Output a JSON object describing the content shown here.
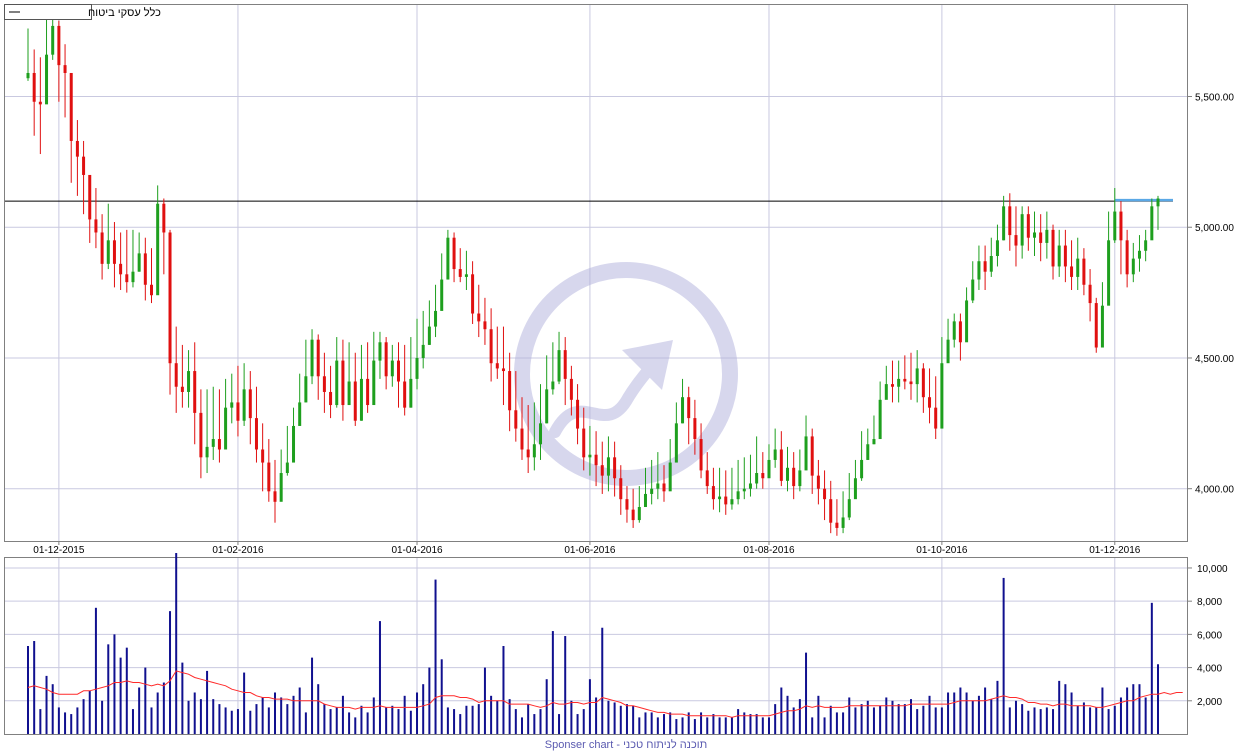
{
  "legend": {
    "instrument": "כלל עסקי ביטוח"
  },
  "footer": {
    "text": "Sponser chart - תוכנה לניתוח טכני"
  },
  "colors": {
    "up": "#1e9f1e",
    "down": "#e01010",
    "volume": "#10108f",
    "volume_ma": "#ff2a2a",
    "grid": "#c9c9e0",
    "resistance": "#000000",
    "trendline": "#5aa8e6",
    "watermark": "#b0b0dc"
  },
  "chart_data": [
    {
      "type": "candlestick",
      "title": "",
      "x_tick_labels": [
        "01-12-2015",
        "01-02-2016",
        "01-04-2016",
        "01-06-2016",
        "01-08-2016",
        "01-10-2016",
        "01-12-2016"
      ],
      "y_tick_labels": [
        "4,000.00",
        "4,500.00",
        "5,000.00",
        "5,500.00"
      ],
      "y_ticks": [
        4000,
        4500,
        5000,
        5500
      ],
      "ylim": [
        3800,
        5850
      ],
      "grid": true,
      "horizontal_line": {
        "value": 5100
      },
      "trendline": {
        "from": "01-12-2016",
        "to": "last",
        "value": 5100
      },
      "series": [
        {
          "name": "",
          "close": [
            5590,
            5480,
            5470,
            5660,
            5770,
            5620,
            5590,
            5330,
            5270,
            5200,
            5030,
            4980,
            4860,
            4950,
            4860,
            4820,
            4790,
            4830,
            4900,
            4780,
            4740,
            5090,
            4980,
            4480,
            4390,
            4370,
            4450,
            4290,
            4120,
            4160,
            4190,
            4150,
            4310,
            4330,
            4260,
            4380,
            4270,
            4150,
            4100,
            3990,
            3950,
            4060,
            4100,
            4240,
            4330,
            4430,
            4570,
            4430,
            4370,
            4320,
            4490,
            4320,
            4410,
            4260,
            4420,
            4320,
            4490,
            4560,
            4430,
            4490,
            4410,
            4310,
            4420,
            4500,
            4550,
            4620,
            4680,
            4800,
            4960,
            4840,
            4810,
            4820,
            4670,
            4640,
            4610,
            4480,
            4460,
            4450,
            4300,
            4230,
            4150,
            4120,
            4170,
            4250,
            4380,
            4410,
            4530,
            4420,
            4340,
            4230,
            4120,
            4130,
            4090,
            4050,
            4120,
            4040,
            3960,
            3920,
            3880,
            3930,
            3980,
            4000,
            4020,
            3990,
            4100,
            4250,
            4350,
            4270,
            4190,
            4070,
            4010,
            3960,
            3970,
            3940,
            3960,
            3990,
            4000,
            4020,
            4060,
            4040,
            4110,
            4150,
            4030,
            4080,
            4010,
            4070,
            4200,
            4050,
            4000,
            3960,
            3870,
            3850,
            3890,
            3960,
            4040,
            4110,
            4170,
            4190,
            4340,
            4400,
            4390,
            4420,
            4410,
            4400,
            4460,
            4350,
            4310,
            4230,
            4480,
            4570,
            4640,
            4560,
            4720,
            4800,
            4870,
            4830,
            4890,
            4950,
            5080,
            4970,
            4930,
            5050,
            4960,
            4980,
            4940,
            4990,
            4850,
            4930,
            4850,
            4810,
            4880,
            4780,
            4710,
            4540,
            4700,
            4950,
            5060,
            4950,
            4820,
            4880,
            4910,
            4950,
            5080,
            5110
          ],
          "high": [
            5760,
            5680,
            5650,
            5800,
            5830,
            5790,
            5700,
            5540,
            5410,
            5330,
            5190,
            5150,
            5050,
            5090,
            5020,
            4980,
            4990,
            4990,
            4980,
            4960,
            4920,
            5160,
            5110,
            4990,
            4620,
            4550,
            4530,
            4560,
            4380,
            4380,
            4390,
            4380,
            4420,
            4440,
            4470,
            4480,
            4450,
            4390,
            4250,
            4190,
            4110,
            4150,
            4240,
            4310,
            4440,
            4570,
            4610,
            4590,
            4520,
            4470,
            4580,
            4570,
            4560,
            4520,
            4550,
            4560,
            4600,
            4600,
            4580,
            4550,
            4560,
            4550,
            4580,
            4650,
            4680,
            4720,
            4780,
            4900,
            4990,
            4980,
            4920,
            4910,
            4870,
            4780,
            4730,
            4690,
            4620,
            4620,
            4520,
            4450,
            4350,
            4320,
            4330,
            4400,
            4510,
            4560,
            4600,
            4580,
            4470,
            4400,
            4310,
            4240,
            4220,
            4180,
            4200,
            4180,
            4090,
            4010,
            4000,
            4010,
            4080,
            4110,
            4140,
            4090,
            4190,
            4330,
            4420,
            4390,
            4340,
            4250,
            4140,
            4080,
            4080,
            4070,
            4080,
            4110,
            4120,
            4130,
            4200,
            4140,
            4170,
            4230,
            4220,
            4160,
            4140,
            4150,
            4280,
            4230,
            4110,
            4070,
            4030,
            3960,
            3990,
            4060,
            4110,
            4220,
            4230,
            4280,
            4410,
            4470,
            4490,
            4490,
            4510,
            4520,
            4530,
            4480,
            4460,
            4430,
            4580,
            4650,
            4670,
            4670,
            4770,
            4870,
            4930,
            4930,
            4960,
            5010,
            5120,
            5130,
            5080,
            5080,
            5080,
            5060,
            5050,
            5060,
            5010,
            4990,
            4990,
            4950,
            4960,
            4920,
            4840,
            4730,
            4790,
            5060,
            5150,
            5100,
            4990,
            4940,
            4970,
            4990,
            5110,
            5120
          ],
          "low": [
            5560,
            5350,
            5280,
            5530,
            5640,
            5480,
            5420,
            5170,
            5120,
            5050,
            4940,
            4920,
            4800,
            4840,
            4770,
            4760,
            4750,
            4770,
            4830,
            4720,
            4710,
            4870,
            4820,
            4360,
            4290,
            4310,
            4310,
            4170,
            4040,
            4060,
            4110,
            4100,
            4220,
            4250,
            4200,
            4240,
            4170,
            4100,
            3990,
            3950,
            3870,
            3980,
            4050,
            4130,
            4250,
            4330,
            4400,
            4340,
            4290,
            4270,
            4310,
            4260,
            4320,
            4240,
            4260,
            4290,
            4390,
            4420,
            4380,
            4390,
            4310,
            4280,
            4310,
            4380,
            4460,
            4550,
            4580,
            4690,
            4800,
            4790,
            4790,
            4760,
            4630,
            4580,
            4550,
            4410,
            4420,
            4320,
            4220,
            4180,
            4110,
            4060,
            4070,
            4110,
            4250,
            4360,
            4400,
            4320,
            4280,
            4170,
            4070,
            4050,
            4010,
            3980,
            3990,
            3970,
            3900,
            3870,
            3850,
            3870,
            3930,
            3940,
            3960,
            3950,
            4030,
            4140,
            4250,
            4170,
            4130,
            4040,
            3980,
            3920,
            3910,
            3900,
            3920,
            3940,
            3960,
            3970,
            4000,
            4000,
            4060,
            4080,
            4010,
            3990,
            3960,
            3990,
            4120,
            3980,
            3940,
            3880,
            3830,
            3820,
            3830,
            3880,
            3980,
            4030,
            4110,
            4170,
            4190,
            4350,
            4330,
            4330,
            4380,
            4340,
            4330,
            4290,
            4250,
            4190,
            4410,
            4490,
            4540,
            4490,
            4590,
            4710,
            4760,
            4760,
            4810,
            4850,
            4950,
            4910,
            4850,
            4880,
            4910,
            4890,
            4870,
            4880,
            4800,
            4810,
            4790,
            4760,
            4760,
            4740,
            4640,
            4520,
            4600,
            4830,
            4940,
            4820,
            4770,
            4790,
            4830,
            4870,
            4970,
            4990
          ],
          "volume_ticks": [
            2000,
            4000,
            6000,
            8000,
            10000
          ],
          "volume_tick_labels": [
            "2,000",
            "4,000",
            "6,000",
            "8,000",
            "10,000"
          ],
          "volume_ylim": [
            0,
            10600
          ],
          "volume": [
            5300,
            5600,
            1500,
            3500,
            3000,
            1600,
            1300,
            1200,
            1600,
            2100,
            2600,
            7600,
            2000,
            5400,
            6000,
            4600,
            5200,
            1500,
            2800,
            4000,
            1600,
            2500,
            3100,
            7400,
            10900,
            4300,
            2000,
            2500,
            2100,
            3800,
            2100,
            1800,
            1600,
            1400,
            1500,
            3700,
            1400,
            1800,
            2200,
            1600,
            2500,
            2200,
            1800,
            2300,
            2800,
            1300,
            4600,
            3000,
            1800,
            1500,
            1600,
            2300,
            1300,
            1000,
            1700,
            1300,
            2200,
            6800,
            1600,
            1700,
            1500,
            2300,
            1400,
            2500,
            3000,
            4000,
            9300,
            4500,
            1600,
            1500,
            1200,
            1700,
            1700,
            1800,
            4000,
            2300,
            2000,
            5300,
            2100,
            1500,
            1000,
            1800,
            1200,
            1500,
            3300,
            6200,
            1200,
            5900,
            2000,
            1200,
            1500,
            3300,
            2200,
            6400,
            2000,
            1900,
            1700,
            1800,
            1700,
            1000,
            1300,
            1300,
            1000,
            1200,
            1300,
            900,
            1000,
            1300,
            900,
            1300,
            1000,
            1200,
            1000,
            1000,
            1000,
            1500,
            1300,
            1200,
            1200,
            1000,
            1000,
            1800,
            2800,
            2300,
            1600,
            2100,
            4900,
            1000,
            2300,
            1000,
            1700,
            1300,
            1300,
            2200,
            1600,
            1800,
            2000,
            1600,
            1700,
            2200,
            2000,
            1800,
            1800,
            2100,
            1500,
            1700,
            2300,
            1600,
            1600,
            2500,
            2500,
            2800,
            2500,
            2000,
            2300,
            2800,
            2100,
            3200,
            9400,
            1600,
            2000,
            1800,
            1400,
            1600,
            1500,
            1600,
            1500,
            3200,
            3000,
            2500,
            1700,
            1900,
            1600,
            1600,
            2800,
            1500,
            1700,
            2200,
            2800,
            3000,
            3000,
            2200,
            7900,
            4200,
            2800,
            2700,
            4600,
            2300,
            3000,
            1300
          ],
          "volume_ma": [
            2800,
            2900,
            2800,
            2700,
            2500,
            2400,
            2400,
            2400,
            2400,
            2600,
            2600,
            2700,
            2800,
            2900,
            3100,
            3100,
            3200,
            3100,
            3100,
            3000,
            2900,
            3000,
            2900,
            3200,
            3800,
            3700,
            3600,
            3400,
            3300,
            3200,
            3100,
            3000,
            2900,
            2700,
            2600,
            2500,
            2500,
            2300,
            2200,
            2200,
            2100,
            2100,
            2100,
            2000,
            2000,
            2000,
            2000,
            2000,
            1800,
            1700,
            1600,
            1600,
            1600,
            1500,
            1600,
            1600,
            1600,
            1700,
            1600,
            1600,
            1600,
            1600,
            1600,
            1600,
            1700,
            1800,
            2200,
            2300,
            2300,
            2300,
            2200,
            2200,
            2100,
            1900,
            2000,
            2000,
            2000,
            2000,
            1800,
            1800,
            1800,
            1800,
            1700,
            1600,
            1700,
            1900,
            1800,
            1800,
            1900,
            1900,
            1800,
            1900,
            1900,
            2200,
            2100,
            2000,
            1900,
            1700,
            1700,
            1600,
            1500,
            1400,
            1300,
            1300,
            1200,
            1200,
            1200,
            1100,
            1100,
            1100,
            1100,
            1100,
            1100,
            1100,
            1000,
            1100,
            1100,
            1100,
            1100,
            1100,
            1100,
            1200,
            1300,
            1400,
            1400,
            1500,
            1700,
            1600,
            1700,
            1600,
            1600,
            1600,
            1600,
            1700,
            1700,
            1700,
            1700,
            1700,
            1700,
            1700,
            1700,
            1700,
            1700,
            1800,
            1800,
            1800,
            1800,
            1800,
            1800,
            1800,
            1900,
            2000,
            2000,
            2000,
            2000,
            2000,
            2100,
            2200,
            2300,
            2200,
            2200,
            2100,
            1900,
            1900,
            1800,
            1800,
            1700,
            1800,
            1800,
            1700,
            1700,
            1700,
            1700,
            1600,
            1600,
            1700,
            1800,
            1900,
            2000,
            2000,
            2200,
            2300,
            2400,
            2400,
            2500,
            2400,
            2500,
            2500
          ]
        }
      ]
    }
  ]
}
